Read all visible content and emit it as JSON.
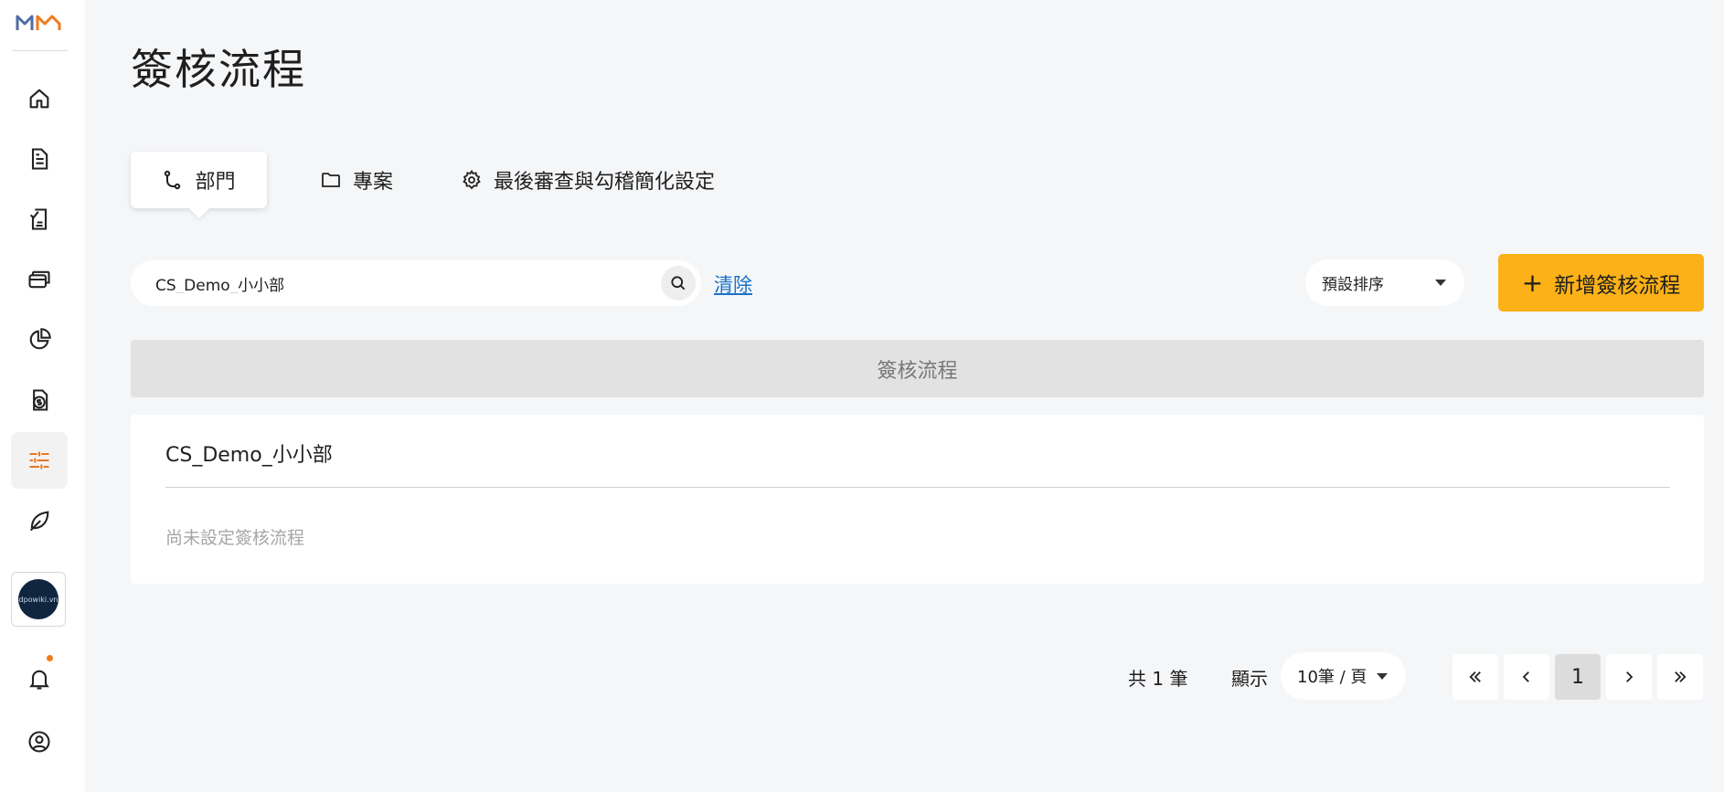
{
  "app": {
    "logo": "logo-mark"
  },
  "sidebar": {
    "items": [
      {
        "name": "home-icon"
      },
      {
        "name": "document-icon"
      },
      {
        "name": "checklist-icon"
      },
      {
        "name": "cards-icon"
      },
      {
        "name": "pie-chart-icon"
      },
      {
        "name": "money-file-icon"
      },
      {
        "name": "sliders-icon",
        "active": true
      },
      {
        "name": "leaf-icon"
      }
    ],
    "org_avatar_text": "dpowiki.vn",
    "notification_icon": "bell-icon",
    "account_icon": "user-circle-icon"
  },
  "page": {
    "title": "簽核流程"
  },
  "tabs": [
    {
      "label": "部門",
      "icon": "branch-icon",
      "active": true
    },
    {
      "label": "專案",
      "icon": "folder-icon",
      "active": false
    },
    {
      "label": "最後審查與勾稽簡化設定",
      "icon": "gear-icon",
      "active": false
    }
  ],
  "search": {
    "value": "CS_Demo_小小部",
    "placeholder": "",
    "clear_label": "清除"
  },
  "sort": {
    "selected": "預設排序"
  },
  "add_button": {
    "label": "新增簽核流程"
  },
  "table": {
    "column_header": "簽核流程",
    "rows": [
      {
        "department": "CS_Demo_小小部",
        "status": "尚未設定簽核流程"
      }
    ]
  },
  "pagination": {
    "total": "共 1 筆",
    "show_label": "顯示",
    "page_size": "10筆 / 頁",
    "current_page": "1"
  },
  "colors": {
    "accent": "#fbb117",
    "active_nav": "#e87722",
    "link": "#1a73c8",
    "background": "#f5f6f8"
  }
}
